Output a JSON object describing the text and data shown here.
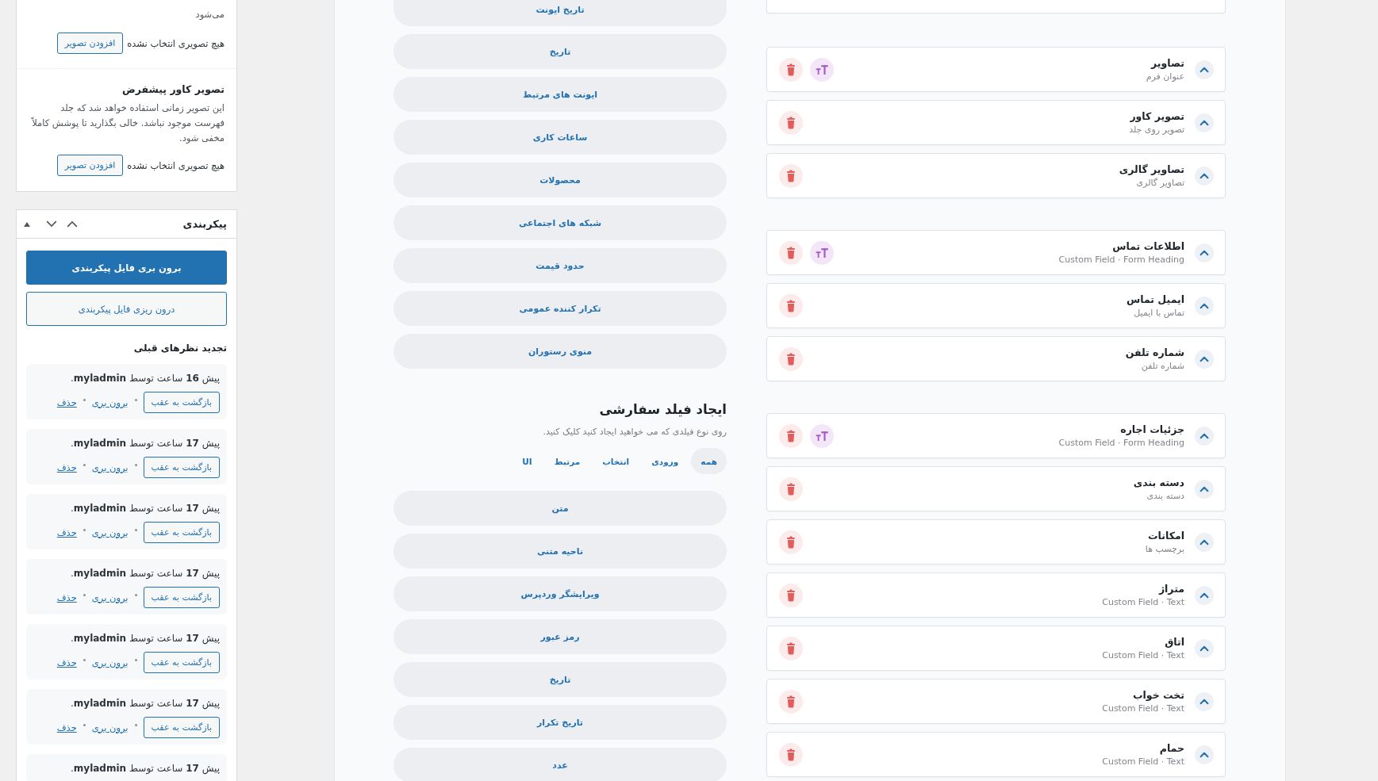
{
  "image_panel": {
    "items": [
      {
        "description": "می‌شود",
        "status": "هیچ تصویری انتخاب نشده",
        "button": "افزودن تصویر"
      },
      {
        "title": "تصویر کاور پیشفرض",
        "description": "این تصویر زمانی استفاده خواهد شد که جلد فهرست موجود نباشد. خالی بگذارید تا پوشش کاملاً مخفی شود.",
        "status": "هیچ تصویری انتخاب نشده",
        "button": "افزودن تصویر"
      }
    ]
  },
  "config_panel": {
    "title": "پیکربندی",
    "export_button": "برون بری فایل پیکربندی",
    "import_button": "درون ریزی فایل پیکربندی",
    "revisions_title": "تجدید نظرهای قبلی",
    "revisions": [
      {
        "text": "پیش **16** ساعت توسط **myladmin**.",
        "restore_button": "بازگشت به عقب",
        "links": [
          "برون بری",
          "حذف"
        ]
      },
      {
        "text": "پیش **17** ساعت توسط **myladmin**.",
        "restore_button": "بازگشت به عقب",
        "links": [
          "برون بری",
          "حذف"
        ]
      },
      {
        "text": "پیش **17** ساعت توسط **myladmin**.",
        "restore_button": "بازگشت به عقب",
        "links": [
          "برون بری",
          "حذف"
        ]
      },
      {
        "text": "پیش **17** ساعت توسط **myladmin**.",
        "restore_button": "بازگشت به عقب",
        "links": [
          "برون بری",
          "حذف"
        ]
      },
      {
        "text": "پیش **17** ساعت توسط **myladmin**.",
        "restore_button": "بازگشت به عقب",
        "links": [
          "برون بری",
          "حذف"
        ]
      },
      {
        "text": "پیش **17** ساعت توسط **myladmin**.",
        "restore_button": "بازگشت به عقب",
        "links": [
          "برون بری",
          "حذف"
        ]
      },
      {
        "text": "پیش **17** ساعت توسط **myladmin**."
      }
    ]
  },
  "field_types": {
    "preset_fields": [
      "تاریخ ایونت",
      "تاریخ",
      "ایونت های مرتبط",
      "ساعات کاری",
      "محصولات",
      "شبکه های اجتماعی",
      "حدود قیمت",
      "تکرار کننده عمومی",
      "منوی رستوران"
    ],
    "custom_heading": "ایجاد فیلد سفارشی",
    "custom_hint": "روی نوع فیلدی که می خواهید ایجاد کنید کلیک کنید.",
    "filters": [
      {
        "label": "همه",
        "selected": true
      },
      {
        "label": "ورودی",
        "selected": false
      },
      {
        "label": "انتخاب",
        "selected": false
      },
      {
        "label": "مرتبط",
        "selected": false
      },
      {
        "label": "UI",
        "selected": false
      }
    ],
    "custom_types": [
      "متن",
      "ناحیه متنی",
      "ویرایشگر وردپرس",
      "رمز عبور",
      "تاریخ",
      "تاریخ تکرار",
      "عدد"
    ]
  },
  "form_fields": {
    "clipped_card_above": true,
    "groups": [
      {
        "fields": [
          {
            "title": "تصاویر",
            "subtitle": "عنوان فرم",
            "kind": "heading"
          },
          {
            "title": "تصویر کاور",
            "subtitle": "تصویر روی جلد",
            "kind": "field"
          },
          {
            "title": "تصاویر گالری",
            "subtitle": "تصاویر گالری",
            "kind": "field"
          }
        ]
      },
      {
        "fields": [
          {
            "title": "اطلاعات تماس",
            "subtitle": "Custom Field · Form Heading",
            "kind": "heading"
          },
          {
            "title": "ایمیل تماس",
            "subtitle": "تماس با ایمیل",
            "kind": "field"
          },
          {
            "title": "شماره تلفن",
            "subtitle": "شماره تلفن",
            "kind": "field"
          }
        ]
      },
      {
        "fields": [
          {
            "title": "جزئیات اجاره",
            "subtitle": "Custom Field · Form Heading",
            "kind": "heading"
          },
          {
            "title": "دسته بندی",
            "subtitle": "دسته بندی",
            "kind": "field"
          },
          {
            "title": "امکانات",
            "subtitle": "برچسب ها",
            "kind": "field"
          },
          {
            "title": "متراژ",
            "subtitle": "Custom Field · Text",
            "kind": "field"
          },
          {
            "title": "اتاق",
            "subtitle": "Custom Field · Text",
            "kind": "field"
          },
          {
            "title": "تخت خواب",
            "subtitle": "Custom Field · Text",
            "kind": "field"
          },
          {
            "title": "حمام",
            "subtitle": "Custom Field · Text",
            "kind": "field"
          }
        ]
      }
    ]
  }
}
